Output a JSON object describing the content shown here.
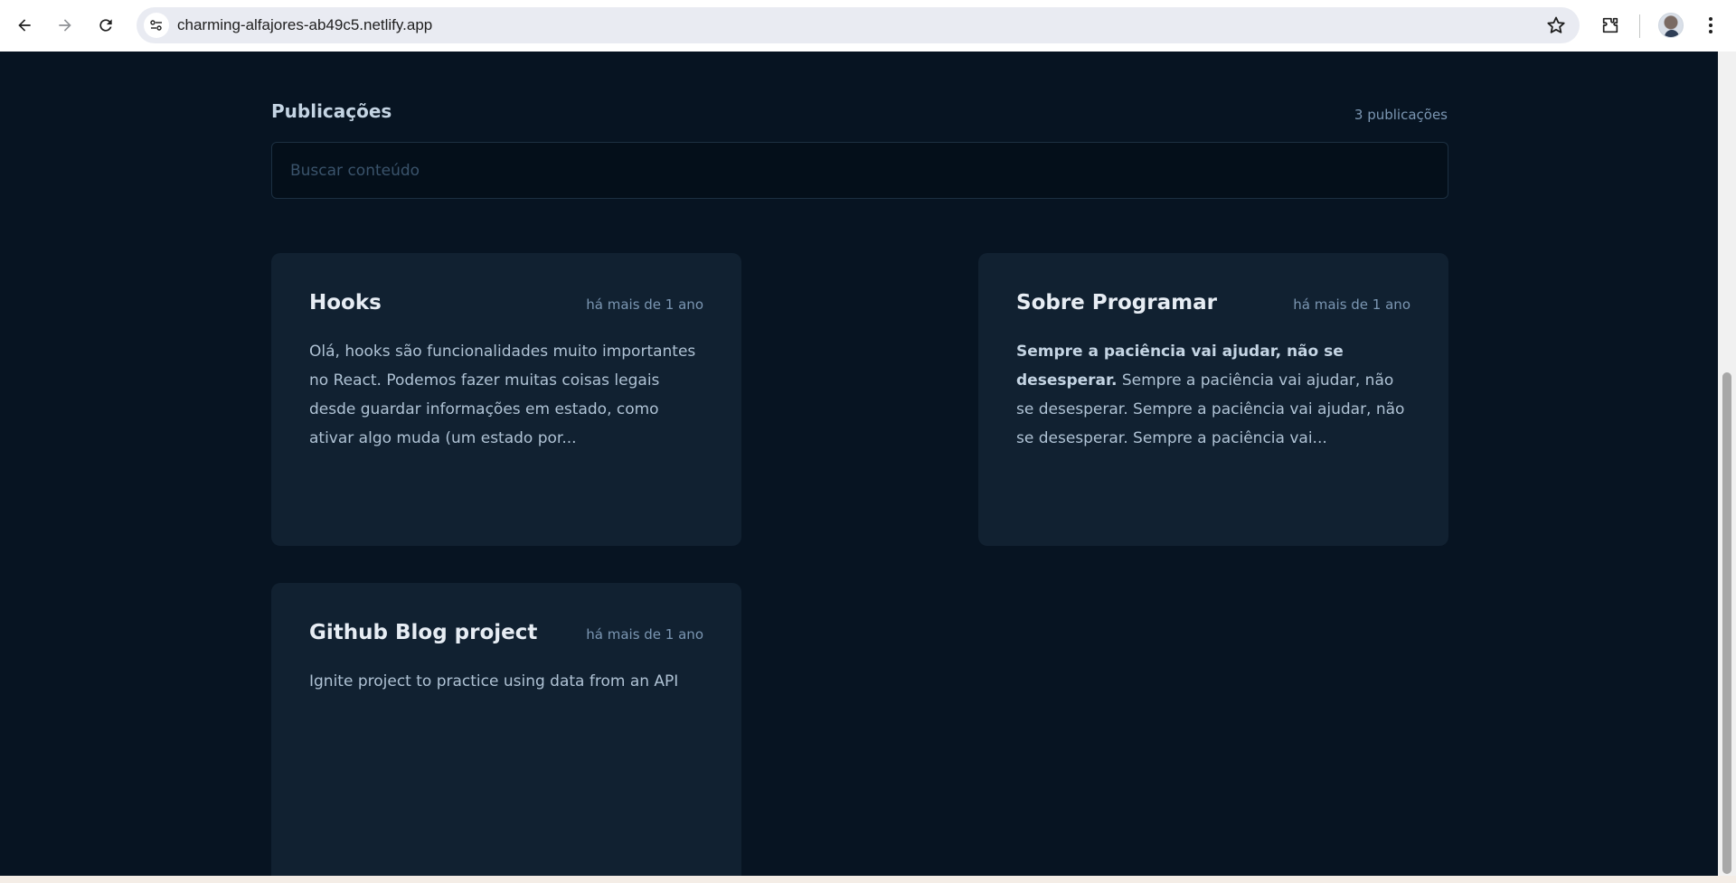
{
  "browser": {
    "url": "charming-alfajores-ab49c5.netlify.app",
    "icons": [
      "back-arrow-icon",
      "forward-arrow-icon",
      "reload-icon",
      "site-info-icon",
      "star-icon",
      "extensions-icon",
      "profile-avatar",
      "more-vert-icon"
    ]
  },
  "page": {
    "section_title": "Publicações",
    "post_count": "3 publicações",
    "search_placeholder": "Buscar conteúdo",
    "colors": {
      "background": "#071422",
      "card": "#112131",
      "input": "#040f1a",
      "muted": "#7b96b2",
      "title": "#e7edf4"
    }
  },
  "posts": [
    {
      "title": "Hooks",
      "date": "há mais de 1 ano",
      "body_bold": "",
      "body": "Olá, hooks são funcionalidades muito importantes no React. Podemos fazer muitas coisas legais desde guardar informações em estado, como ativar algo muda (um estado por..."
    },
    {
      "title": "Sobre Programar",
      "date": "há mais de 1 ano",
      "body_bold": "Sempre a paciência vai ajudar, não se desesperar.",
      "body": " Sempre a paciência vai ajudar, não se desesperar. Sempre a paciência vai ajudar, não se desesperar. Sempre a paciência vai..."
    },
    {
      "title": "Github Blog project",
      "date": "há mais de 1 ano",
      "body_bold": "",
      "body": "Ignite project to practice using data from an API"
    }
  ]
}
